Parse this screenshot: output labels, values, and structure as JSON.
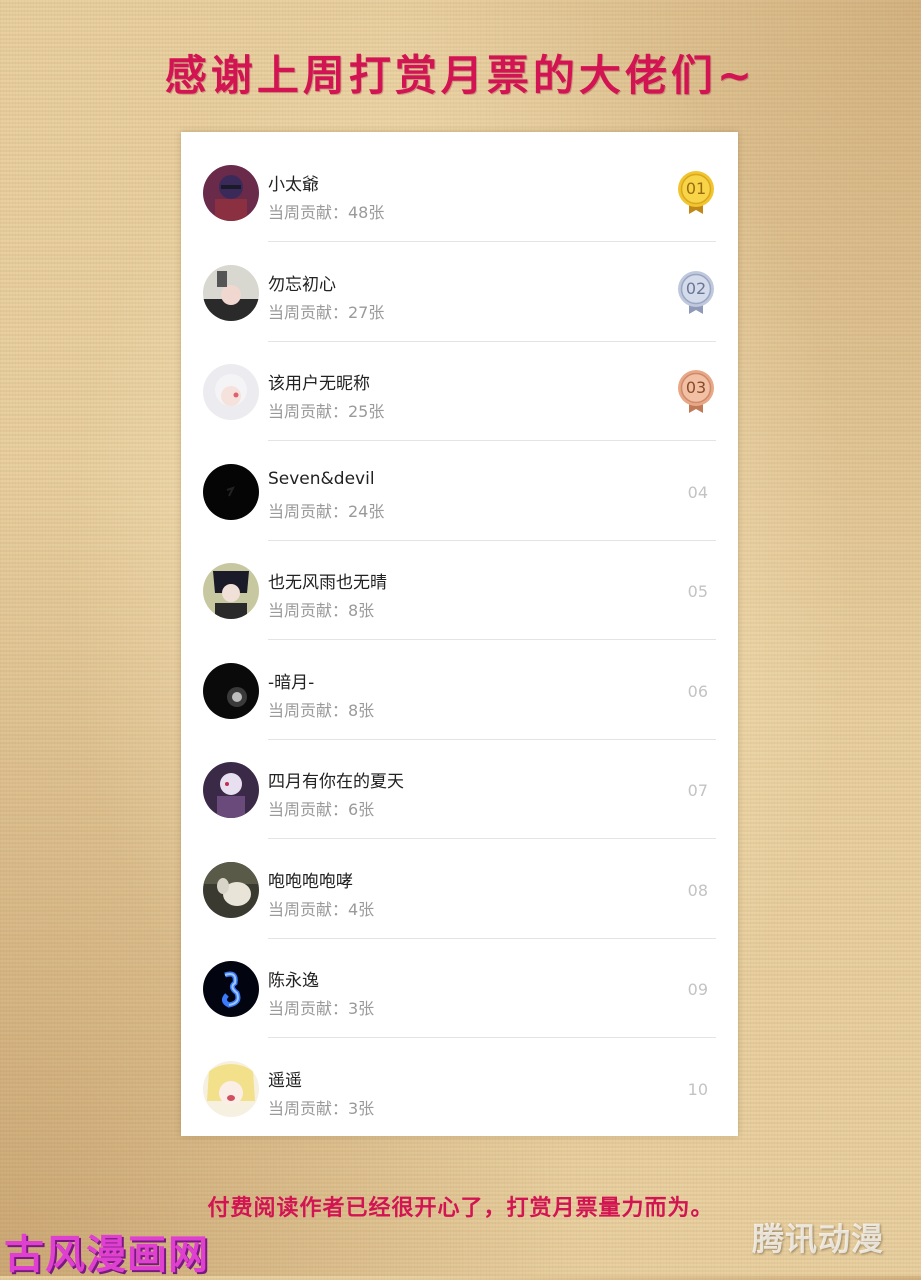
{
  "header": {
    "title": "感谢上周打赏月票的大佬们~"
  },
  "leaderboard": [
    {
      "name": "小太爺",
      "contribution": "当周贡献：48张",
      "rank": "01",
      "medal": "gold"
    },
    {
      "name": "勿忘初心",
      "contribution": "当周贡献：27张",
      "rank": "02",
      "medal": "silver"
    },
    {
      "name": "该用户无昵称",
      "contribution": "当周贡献：25张",
      "rank": "03",
      "medal": "bronze"
    },
    {
      "name": "Seven&devil",
      "contribution": "当周贡献：24张",
      "rank": "04"
    },
    {
      "name": "也无风雨也无晴",
      "contribution": "当周贡献：8张",
      "rank": "05"
    },
    {
      "name": "-暗月-",
      "contribution": "当周贡献：8张",
      "rank": "06"
    },
    {
      "name": "四月有你在的夏天",
      "contribution": "当周贡献：6张",
      "rank": "07"
    },
    {
      "name": "咆咆咆咆哮",
      "contribution": "当周贡献：4张",
      "rank": "08"
    },
    {
      "name": "陈永逸",
      "contribution": "当周贡献：3张",
      "rank": "09"
    },
    {
      "name": "遥遥",
      "contribution": "当周贡献：3张",
      "rank": "10"
    }
  ],
  "footer": {
    "text": "付费阅读作者已经很开心了，打赏月票量力而为。"
  },
  "watermarks": {
    "left": "古风漫画网",
    "right": "腾讯动漫"
  },
  "colors": {
    "accent": "#d21452",
    "gold": "#e8b420",
    "silver": "#aeb8d0",
    "bronze": "#e0a080",
    "watermark_left": "#e040d0"
  },
  "icons": {
    "medal_gold": "medal-gold-icon",
    "medal_silver": "medal-silver-icon",
    "medal_bronze": "medal-bronze-icon"
  }
}
